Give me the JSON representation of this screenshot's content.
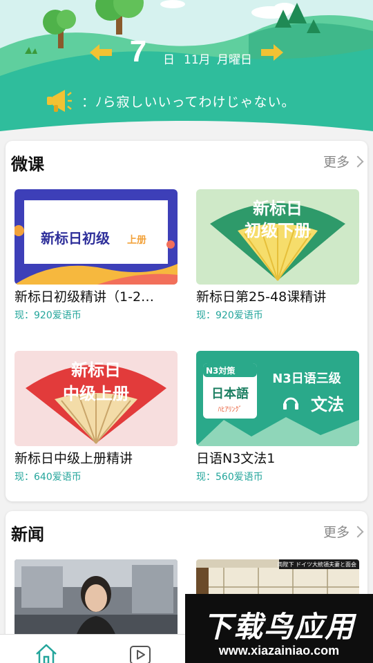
{
  "header": {
    "day": "7",
    "day_unit": "日",
    "month": "11月",
    "weekday": "月曜日",
    "announcement": "：ﾉら寂しいいってわけじゃない。",
    "colors": {
      "sky": "#d6f2ef",
      "hill": "#2fbd9c",
      "arrow": "#f2c233"
    }
  },
  "weike": {
    "title": "微课",
    "more_label": "更多",
    "courses": [
      {
        "title": "新标日初级精讲（1-2…",
        "price": "现：920爱语币",
        "thumb_text": "新标日初级",
        "thumb_badge": "上册"
      },
      {
        "title": "新标日第25-48课精讲",
        "price": "现：920爱语币",
        "thumb_text_1": "新标日",
        "thumb_text_2": "初级下册"
      },
      {
        "title": "新标日中级上册精讲",
        "price": "现：640爱语币",
        "thumb_text_1": "新标日",
        "thumb_text_2": "中级上册"
      },
      {
        "title": "日语N3文法1",
        "price": "现：560爱语币",
        "thumb_badge": "N3対策",
        "thumb_logo": "日本語",
        "thumb_sub": "ﾊﾋｱﾘﾝｸﾞ",
        "thumb_text_1": "N3日语三级",
        "thumb_text_2": "文法"
      }
    ]
  },
  "news": {
    "title": "新闻",
    "more_label": "更多",
    "items": [
      {
        "caption": ""
      },
      {
        "caption": "両陛下 ドイツ大統領夫妻と面会"
      }
    ]
  },
  "watermark": {
    "title": "下载鸟应用",
    "url": "www.xiazainiao.com"
  },
  "colors": {
    "accent": "#23a59b"
  }
}
